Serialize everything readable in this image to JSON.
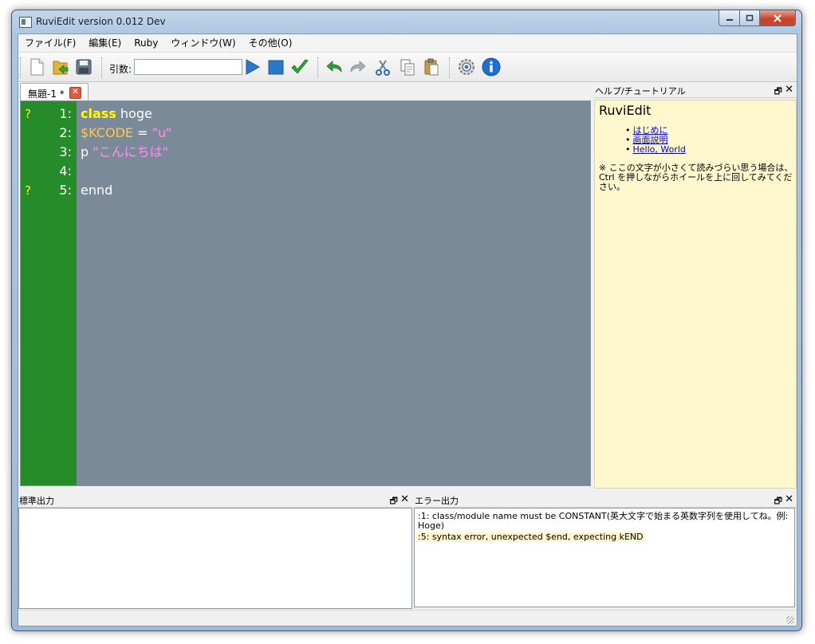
{
  "window": {
    "title": "RuviEdit version 0.012 Dev",
    "min": "‒",
    "max": "▫",
    "close": "✕"
  },
  "menu": [
    "ファイル(F)",
    "編集(E)",
    "Ruby",
    "ウィンドウ(W)",
    "その他(O)"
  ],
  "toolbar": {
    "args_label": "引数:",
    "args_value": ""
  },
  "tab": {
    "label": "無題-1 *",
    "close": "✕"
  },
  "editor": {
    "lines": [
      {
        "num": "1:",
        "warn": "?"
      },
      {
        "num": "2:",
        "warn": ""
      },
      {
        "num": "3:",
        "warn": ""
      },
      {
        "num": "4:",
        "warn": ""
      },
      {
        "num": "5:",
        "warn": "?"
      }
    ],
    "tokens": {
      "l1_kw": "class",
      "l1_rest": " hoge",
      "l2_var": "$KCODE",
      "l2_eq": " = ",
      "l2_str": "\"u\"",
      "l3_p": "p ",
      "l3_str": "\"こんにちは\"",
      "l5": "ennd"
    }
  },
  "help": {
    "header": "ヘルプ/チュートリアル",
    "title": "RuviEdit",
    "links": [
      "はじめに",
      "画面説明",
      "Hello, World"
    ],
    "note": "※ ここの文字が小さくて読みづらい思う場合は、Ctrl を押しながらホイールを上に回してみてください。"
  },
  "stdout": {
    "header": "標準出力"
  },
  "errors": {
    "header": "エラー出力",
    "lines": [
      ":1: class/module name must be CONSTANT(英大文字で始まる英数字列を使用してね。例: Hoge)",
      ":5: syntax error, unexpected $end, expecting kEND"
    ]
  },
  "pane_controls": {
    "float": "🗗",
    "close": "✕"
  }
}
